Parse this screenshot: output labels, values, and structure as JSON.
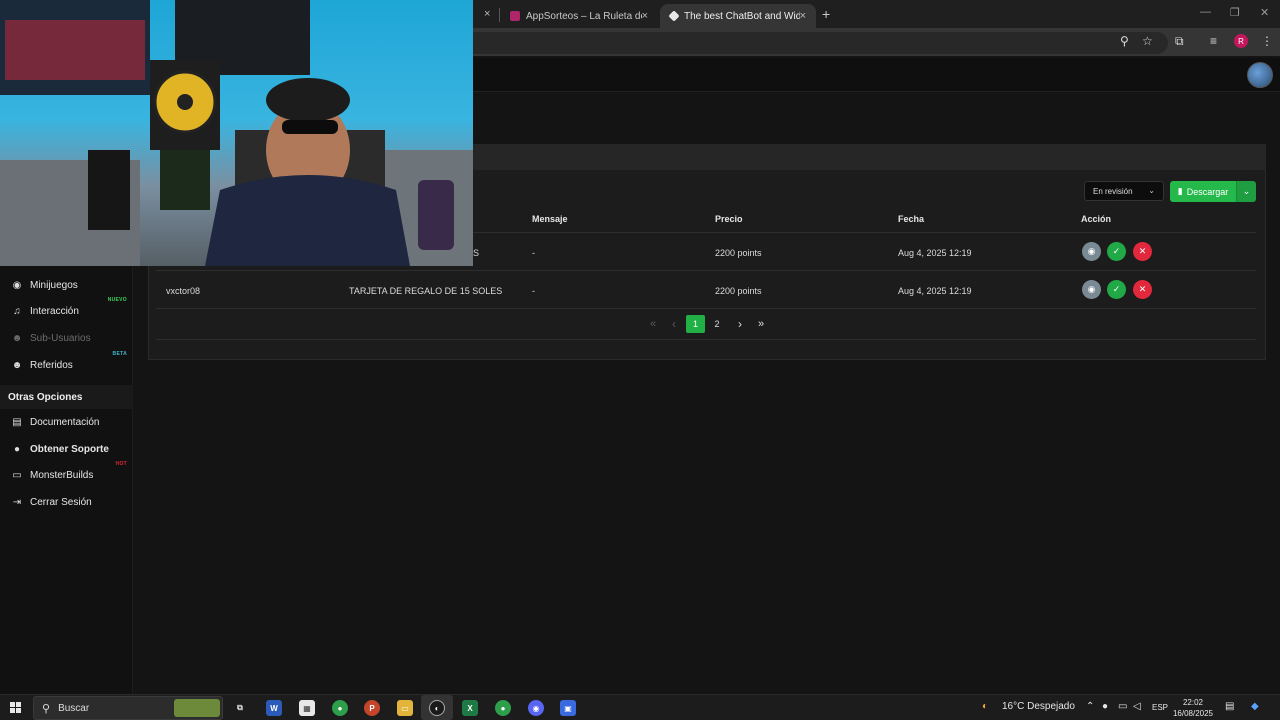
{
  "browser": {
    "tabs": [
      {
        "label": "AppSorteos – La Ruleta de la Su",
        "active": false
      },
      {
        "label": "The best ChatBot and Widgets",
        "active": true
      }
    ],
    "new_tab": "+",
    "close": "×",
    "profile_letter": "R"
  },
  "sidebar": {
    "items": [
      {
        "label": "Minijuegos",
        "icon": "gamepad-icon"
      },
      {
        "label": "Interacción",
        "icon": "music-note-icon",
        "badge": "NUEVO"
      },
      {
        "label": "Sub-Usuarios",
        "icon": "users-icon"
      },
      {
        "label": "Referidos",
        "icon": "user-group-icon",
        "badge": "BETA"
      }
    ],
    "section_title": "Otras Opciones",
    "other_items": [
      {
        "label": "Documentación",
        "icon": "book-icon"
      },
      {
        "label": "Obtener Soporte",
        "icon": "help-circle-icon"
      },
      {
        "label": "MonsterBuilds",
        "icon": "laptop-icon",
        "badge": "HOT"
      },
      {
        "label": "Cerrar Sesión",
        "icon": "logout-icon"
      }
    ]
  },
  "toolbar": {
    "status_filter": "En revisión",
    "download_label": "Descargar"
  },
  "table": {
    "columns": [
      "Mensaje",
      "Precio",
      "Fecha",
      "Acción"
    ],
    "rows": [
      {
        "user": "",
        "reward_visible": "S",
        "message": "-",
        "price": "2200 points",
        "date": "Aug 4, 2025 12:19"
      },
      {
        "user": "vxctor08",
        "reward": "TARJETA DE REGALO DE 15 SOLES",
        "message": "-",
        "price": "2200 points",
        "date": "Aug 4, 2025 12:19"
      }
    ]
  },
  "pagination": {
    "first": "«",
    "prev": "‹",
    "pages": [
      "1",
      "2"
    ],
    "current": "1",
    "next": "›",
    "last": "»"
  },
  "taskbar": {
    "search_placeholder": "Buscar",
    "weather": "16°C  Despejado",
    "language": "ESP",
    "time": "22:02",
    "date": "16/08/2025"
  },
  "colors": {
    "accent_green": "#25b84b",
    "danger_red": "#e2283d",
    "badge_nuevo": "#3fd15a",
    "badge_beta": "#3fb6c9",
    "badge_hot": "#e0283a"
  }
}
